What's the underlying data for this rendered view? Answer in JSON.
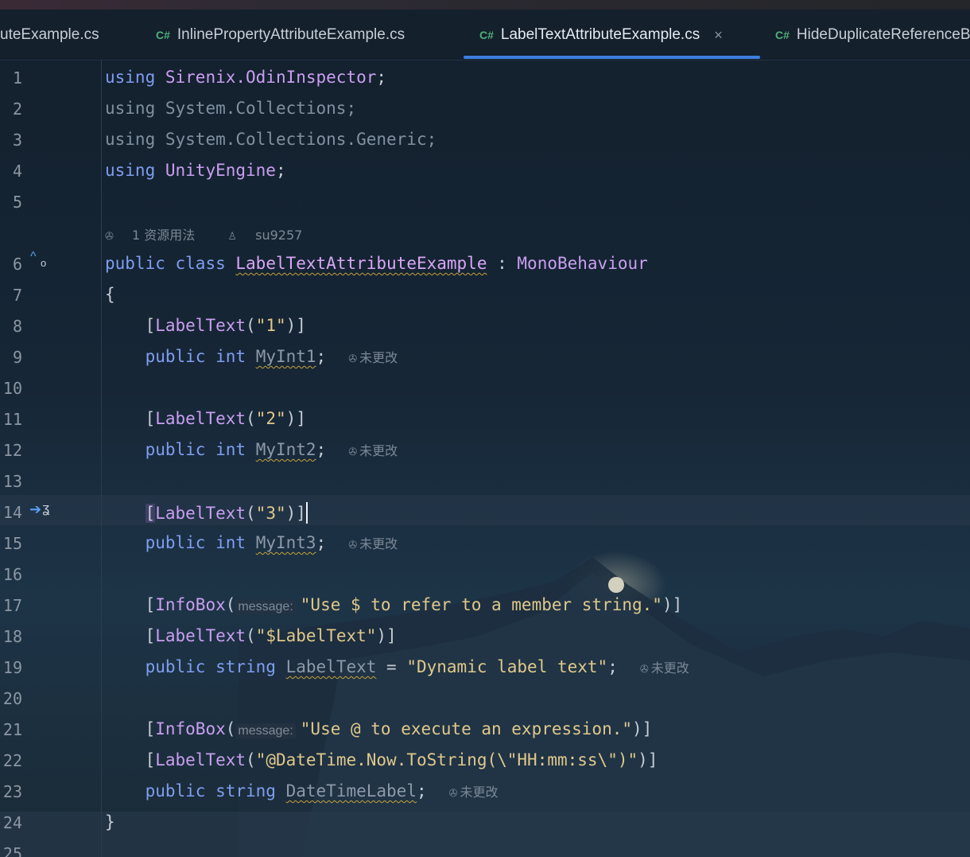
{
  "tabs": [
    {
      "label": "uteExample.cs",
      "icon": "",
      "active": false
    },
    {
      "label": "InlinePropertyAttributeExample.cs",
      "icon": "C#",
      "active": false
    },
    {
      "label": "LabelTextAttributeExample.cs",
      "icon": "C#",
      "active": true,
      "close": "×"
    },
    {
      "label": "HideDuplicateReferenceB",
      "icon": "C#",
      "active": false
    }
  ],
  "codelens": {
    "usages": "1 资源用法",
    "author": "su9257"
  },
  "inlay_unchanged": "未更改",
  "param_hint": "message:",
  "lines": {
    "l1": {
      "n": "1",
      "a": "using",
      "b": "Sirenix.OdinInspector",
      "c": ";"
    },
    "l2": {
      "n": "2",
      "a": "using",
      "b": "System.Collections;"
    },
    "l3": {
      "n": "3",
      "a": "using",
      "b": "System.Collections.Generic;"
    },
    "l4": {
      "n": "4",
      "a": "using",
      "b": "UnityEngine",
      "c": ";"
    },
    "l5": {
      "n": "5"
    },
    "l6": {
      "n": "6",
      "a": "public",
      "b": "class",
      "c": "LabelTextAttributeExample",
      "d": " : ",
      "e": "MonoBehaviour"
    },
    "l7": {
      "n": "7",
      "a": "{"
    },
    "l8": {
      "n": "8",
      "a": "[",
      "b": "LabelText",
      "c": "(",
      "d": "\"1\"",
      "e": ")]"
    },
    "l9": {
      "n": "9",
      "a": "public",
      "b": "int",
      "c": "MyInt1",
      "d": ";"
    },
    "l10": {
      "n": "10"
    },
    "l11": {
      "n": "11",
      "a": "[",
      "b": "LabelText",
      "c": "(",
      "d": "\"2\"",
      "e": ")]"
    },
    "l12": {
      "n": "12",
      "a": "public",
      "b": "int",
      "c": "MyInt2",
      "d": ";"
    },
    "l13": {
      "n": "13"
    },
    "l14": {
      "n": "14",
      "a": "[",
      "b": "LabelText",
      "c": "(",
      "d": "\"3\"",
      "e": ")]"
    },
    "l15": {
      "n": "15",
      "a": "public",
      "b": "int",
      "c": "MyInt3",
      "d": ";"
    },
    "l16": {
      "n": "16"
    },
    "l17": {
      "n": "17",
      "a": "[",
      "b": "InfoBox",
      "c": "(",
      "d": "\"Use $ to refer to a member string.\"",
      "e": ")]"
    },
    "l18": {
      "n": "18",
      "a": "[",
      "b": "LabelText",
      "c": "(",
      "d": "\"$LabelText\"",
      "e": ")]"
    },
    "l19": {
      "n": "19",
      "a": "public",
      "b": "string",
      "c": "LabelText",
      "d": " = ",
      "e": "\"Dynamic label text\"",
      "f": ";"
    },
    "l20": {
      "n": "20"
    },
    "l21": {
      "n": "21",
      "a": "[",
      "b": "InfoBox",
      "c": "(",
      "d": "\"Use @ to execute an expression.\"",
      "e": ")]"
    },
    "l22": {
      "n": "22",
      "a": "[",
      "b": "LabelText",
      "c": "(",
      "d": "\"@DateTime.Now.ToString(\\\"HH:mm:ss\\\")\"",
      "e": ")]"
    },
    "l23": {
      "n": "23",
      "a": "public",
      "b": "string",
      "c": "DateTimeLabel",
      "d": ";"
    },
    "l24": {
      "n": "24",
      "a": "}"
    },
    "l25": {
      "n": "25"
    }
  },
  "colors": {
    "accent": "#3d7ee0",
    "keyword": "#7e9ef0",
    "type": "#c99ff0",
    "string": "#e0c88a"
  }
}
